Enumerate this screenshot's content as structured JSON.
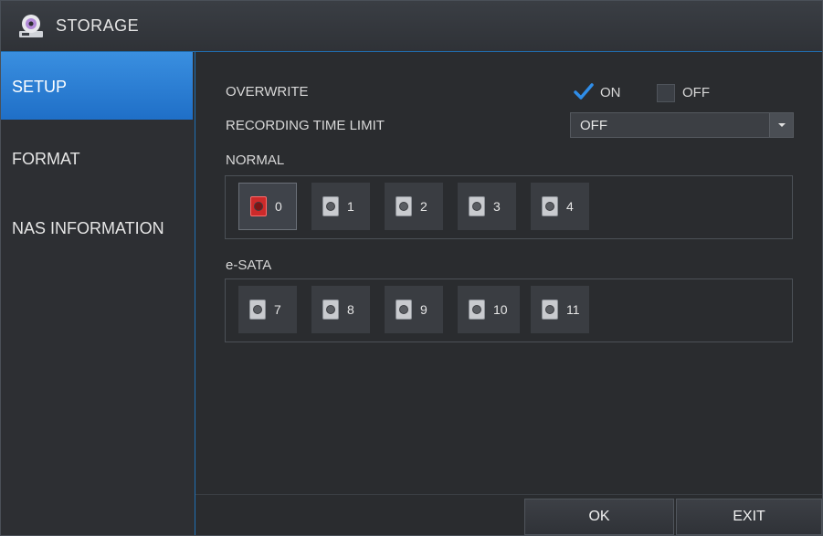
{
  "window": {
    "title": "STORAGE",
    "icon": "disc-drive-icon"
  },
  "sidebar": {
    "items": [
      {
        "label": "SETUP",
        "active": true
      },
      {
        "label": "FORMAT",
        "active": false
      },
      {
        "label": "NAS INFORMATION",
        "active": false
      }
    ]
  },
  "setup": {
    "overwrite": {
      "label": "OVERWRITE",
      "on_label": "ON",
      "off_label": "OFF",
      "selected": "ON"
    },
    "recording_time_limit": {
      "label": "RECORDING TIME LIMIT",
      "value": "OFF"
    },
    "normal": {
      "label": "NORMAL",
      "disks": [
        "0",
        "1",
        "2",
        "3",
        "4"
      ],
      "selected": "0"
    },
    "esata": {
      "label": "e-SATA",
      "disks": [
        "7",
        "8",
        "9",
        "10",
        "11"
      ]
    }
  },
  "footer": {
    "ok_label": "OK",
    "exit_label": "EXIT"
  },
  "colors": {
    "accent": "#1f6fc7",
    "check": "#2f8de8",
    "selected_disk": "#cc2a2a"
  }
}
